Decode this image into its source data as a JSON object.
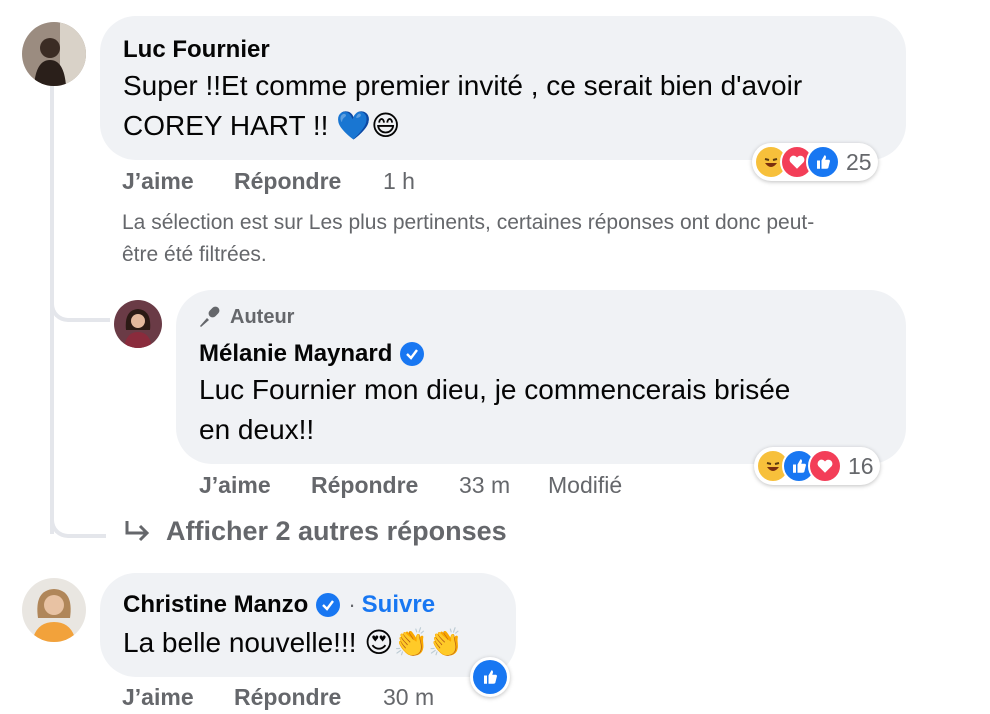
{
  "comment1": {
    "author": "Luc Fournier",
    "text_line1": "Super !!Et comme premier invité , ce serait bien d'avoir",
    "text_line2": "COREY HART !!",
    "emojis": "💙😄",
    "like_label": "J’aime",
    "reply_label": "Répondre",
    "time": "1 h",
    "reaction_count": "25"
  },
  "filter_notice_line1": "La sélection est sur Les plus pertinents, certaines réponses ont donc peut-",
  "filter_notice_line2": "être été filtrées.",
  "reply1": {
    "badge_label": "Auteur",
    "author": "Mélanie Maynard",
    "text_line1": "Luc Fournier mon dieu, je commencerais brisée",
    "text_line2": "en deux!!",
    "like_label": "J’aime",
    "reply_label": "Répondre",
    "time": "33 m",
    "edited_label": "Modifié",
    "reaction_count": "16"
  },
  "more_replies_label": "Afficher 2 autres réponses",
  "comment2": {
    "author": "Christine Manzo",
    "separator": "·",
    "follow_label": "Suivre",
    "text": "La belle nouvelle!!!",
    "emojis": "😍👏👏",
    "like_label": "J’aime",
    "reply_label": "Répondre",
    "time": "30 m"
  },
  "colors": {
    "bubble": "#f0f2f5",
    "secondary_text": "#65676b",
    "link_blue": "#1877f2",
    "thread_line": "#e4e6eb"
  }
}
